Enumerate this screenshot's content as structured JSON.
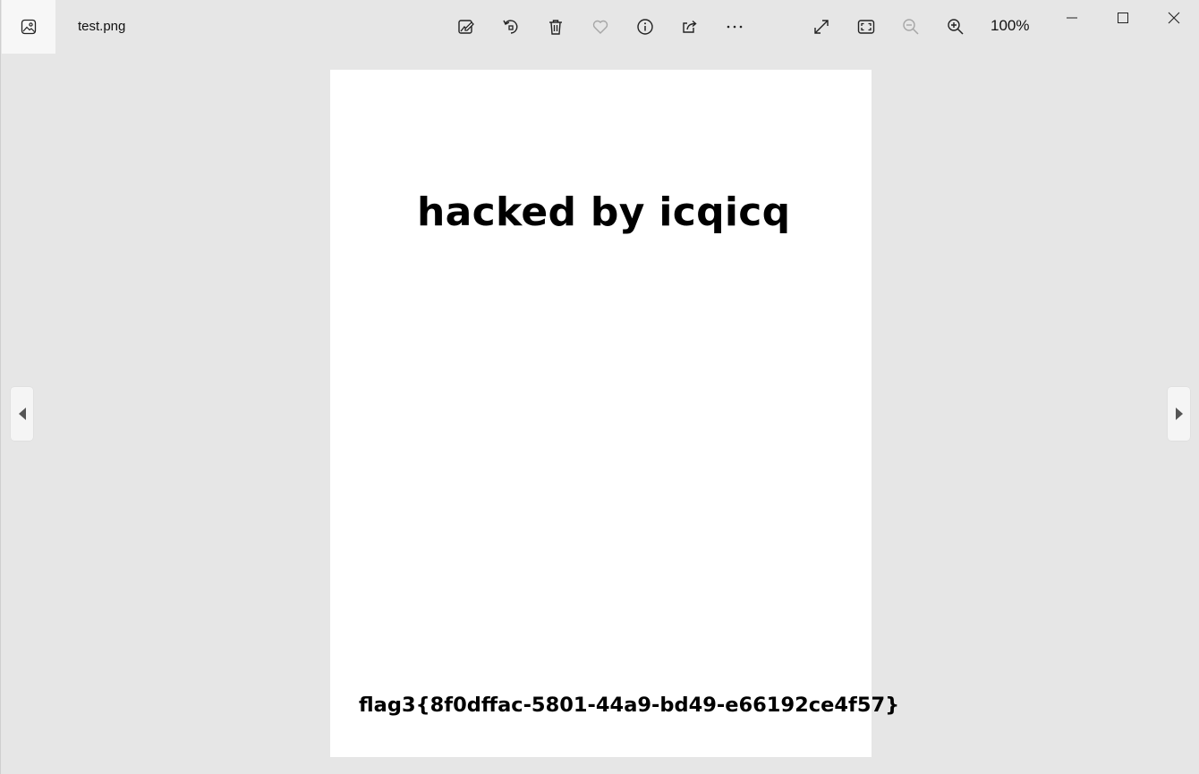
{
  "window": {
    "file_name": "test.png",
    "zoom_level": "100%"
  },
  "toolbar": {
    "items": [
      {
        "name": "edit-image-icon"
      },
      {
        "name": "rotate-icon"
      },
      {
        "name": "delete-icon"
      },
      {
        "name": "favorite-heart-icon"
      },
      {
        "name": "info-icon"
      },
      {
        "name": "share-icon"
      },
      {
        "name": "more-options-icon"
      },
      {
        "name": "expand-icon"
      },
      {
        "name": "fit-to-window-icon"
      },
      {
        "name": "zoom-out-icon"
      },
      {
        "name": "zoom-in-icon"
      }
    ]
  },
  "image": {
    "headline": "hacked by icqicq",
    "flag": "flag3{8f0dffac-5801-44a9-bd49-e66192ce4f57}"
  },
  "colors": {
    "background": "#e6e6e6",
    "page": "#ffffff",
    "text": "#000000"
  }
}
